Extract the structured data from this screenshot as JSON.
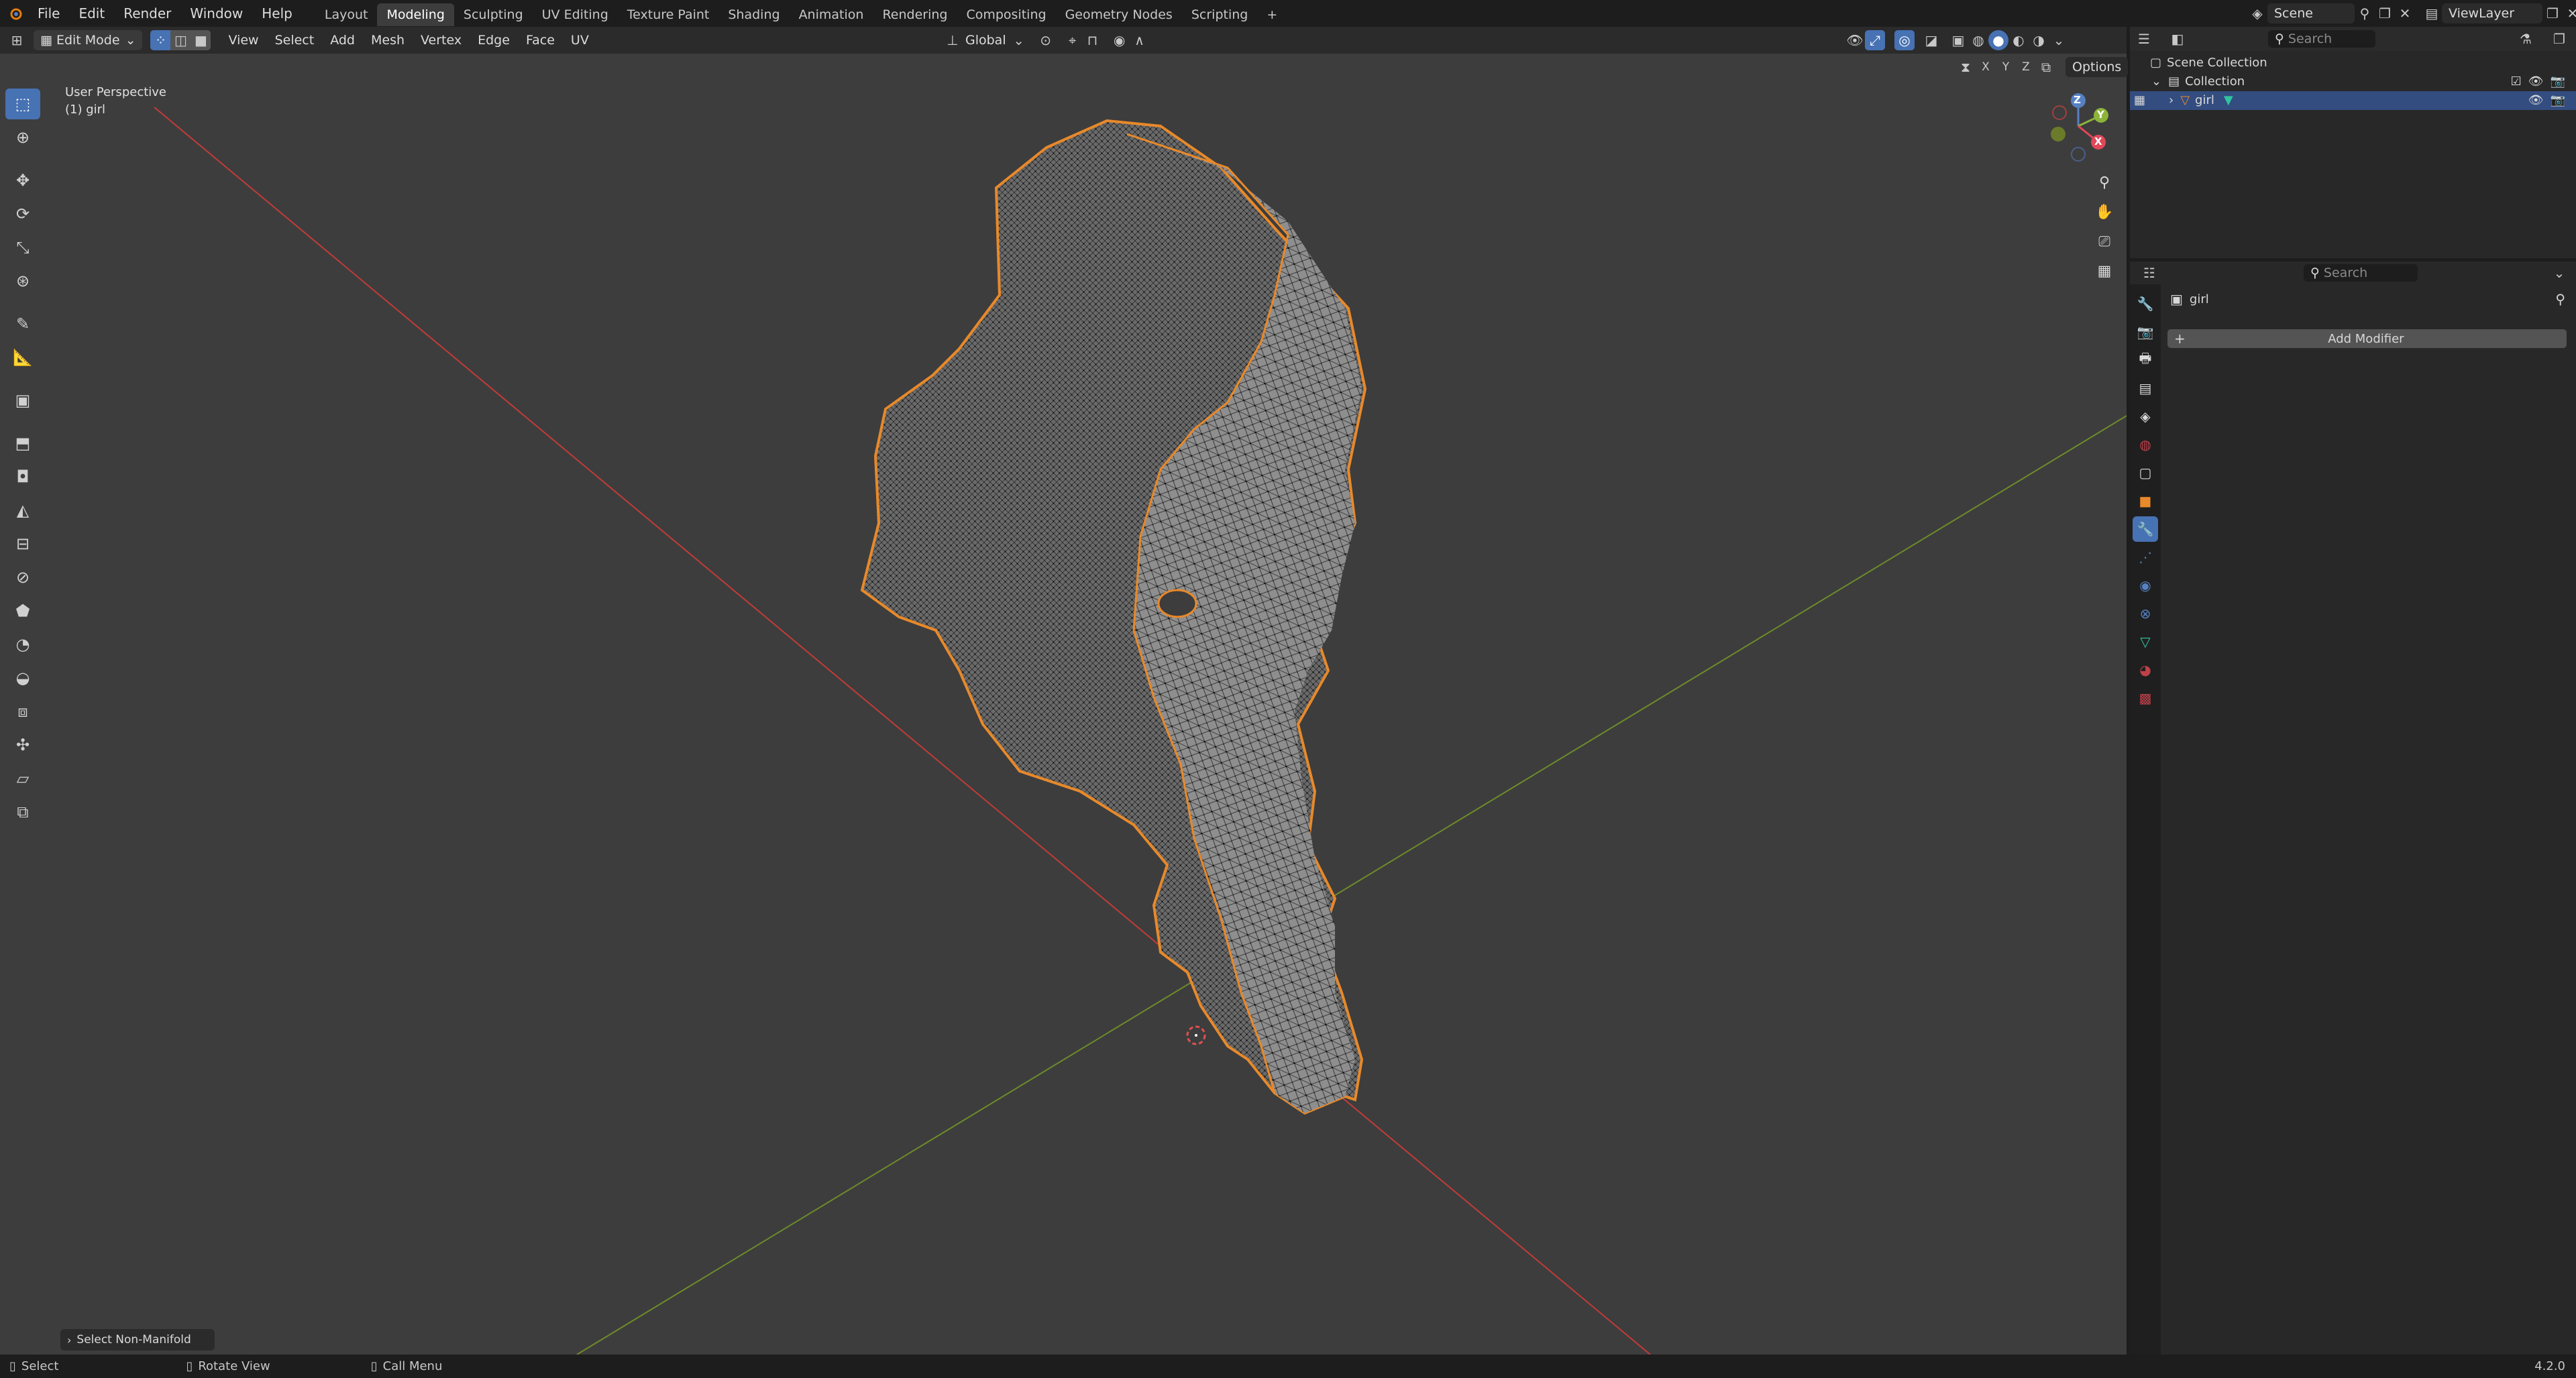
{
  "topbar": {
    "menus": [
      "File",
      "Edit",
      "Render",
      "Window",
      "Help"
    ],
    "workspaces": [
      "Layout",
      "Modeling",
      "Sculpting",
      "UV Editing",
      "Texture Paint",
      "Shading",
      "Animation",
      "Rendering",
      "Compositing",
      "Geometry Nodes",
      "Scripting"
    ],
    "active_workspace": "Modeling",
    "add_tab": "+",
    "scene": "Scene",
    "view_layer": "ViewLayer"
  },
  "header": {
    "mode": "Edit Mode",
    "menus": [
      "View",
      "Select",
      "Add",
      "Mesh",
      "Vertex",
      "Edge",
      "Face",
      "UV"
    ],
    "orientation": "Global",
    "axes": [
      "X",
      "Y",
      "Z"
    ],
    "options": "Options"
  },
  "viewport": {
    "perspective": "User Perspective",
    "object_label": "(1) girl",
    "last_operator": "Select Non-Manifold",
    "gizmo_axes": [
      "Z",
      "Y",
      "X"
    ]
  },
  "outliner": {
    "search_placeholder": "Search",
    "scene_collection": "Scene Collection",
    "collection": "Collection",
    "object": "girl"
  },
  "properties": {
    "search_placeholder": "Search",
    "object_name": "girl",
    "add_modifier": "Add Modifier"
  },
  "statusbar": {
    "select": "Select",
    "rotate": "Rotate View",
    "call_menu": "Call Menu",
    "version": "4.2.0"
  },
  "colors": {
    "accent": "#4772b3",
    "selection_outline": "#e8892a",
    "x_axis": "#c23b3b",
    "y_axis": "#6e8b2a",
    "viewport_bg": "#3d3d3d"
  }
}
